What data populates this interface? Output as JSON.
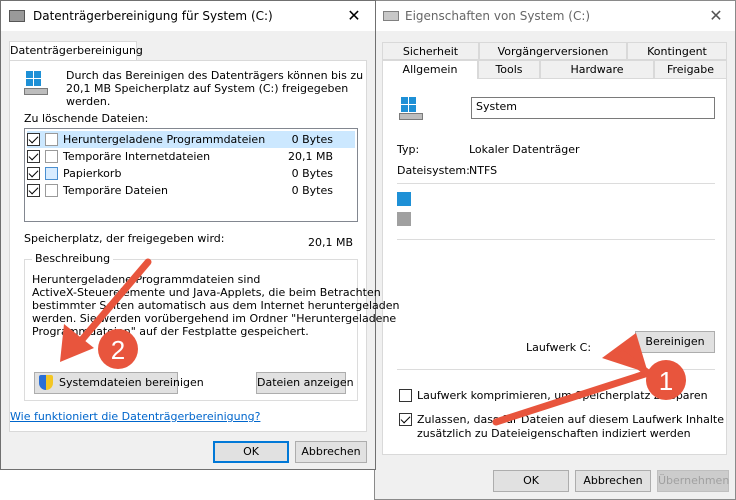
{
  "left_window": {
    "title": "Datenträgerbereinigung für System (C:)",
    "tab": "Datenträgerbereinigung",
    "intro": [
      "Durch das Bereinigen des Datenträgers können bis zu",
      "20,1 MB Speicherplatz auf System (C:) freigegeben",
      "werden."
    ],
    "files_label": "Zu löschende Dateien:",
    "files": [
      {
        "name": "Heruntergeladene Programmdateien",
        "size": "0 Bytes",
        "checked": true,
        "selected": true
      },
      {
        "name": "Temporäre Internetdateien",
        "size": "20,1 MB",
        "checked": true,
        "selected": false
      },
      {
        "name": "Papierkorb",
        "size": "0 Bytes",
        "checked": true,
        "selected": false
      },
      {
        "name": "Temporäre Dateien",
        "size": "0 Bytes",
        "checked": true,
        "selected": false
      }
    ],
    "freed_label": "Speicherplatz, der freigegeben wird:",
    "freed_value": "20,1 MB",
    "description_title": "Beschreibung",
    "description": [
      "Heruntergeladene Programmdateien sind",
      "ActiveX-Steuerelemente und Java-Applets, die beim Betrachten",
      "bestimmter Seiten automatisch aus dem Internet heruntergeladen",
      "werden. Sie werden vorübergehend im Ordner \"Heruntergeladene",
      "Programmdateien\" auf der Festplatte gespeichert."
    ],
    "btn_system": "Systemdateien bereinigen",
    "btn_view": "Dateien anzeigen",
    "help_link": "Wie funktioniert die Datenträgerbereinigung?",
    "btn_ok": "OK",
    "btn_cancel": "Abbrechen"
  },
  "right_window": {
    "title": "Eigenschaften von System (C:)",
    "tabs_row1": [
      "Sicherheit",
      "Vorgängerversionen",
      "Kontingent"
    ],
    "tabs_row2": [
      "Allgemein",
      "Tools",
      "Hardware",
      "Freigabe"
    ],
    "name_value": "System",
    "type_label": "Typ:",
    "type_value": "Lokaler Datenträger",
    "fs_label": "Dateisystem:",
    "fs_value": "NTFS",
    "drive_label": "Laufwerk C:",
    "btn_clean": "Bereinigen",
    "compress_label": "Laufwerk komprimieren, um Speicherplatz zu sparen",
    "compress_checked": false,
    "index_label_1": "Zulassen, dass für Dateien auf diesem Laufwerk Inhalte",
    "index_label_2": "zusätzlich zu Dateieigenschaften indiziert werden",
    "index_checked": true,
    "btn_ok": "OK",
    "btn_cancel": "Abbrechen",
    "btn_apply": "Übernehmen"
  },
  "annotations": {
    "marker_1": "1",
    "marker_2": "2"
  },
  "colors": {
    "arrow": "#e8553d",
    "selection": "#cce8ff",
    "used_space": "#1e90d6",
    "free_space": "#a0a0a0"
  }
}
